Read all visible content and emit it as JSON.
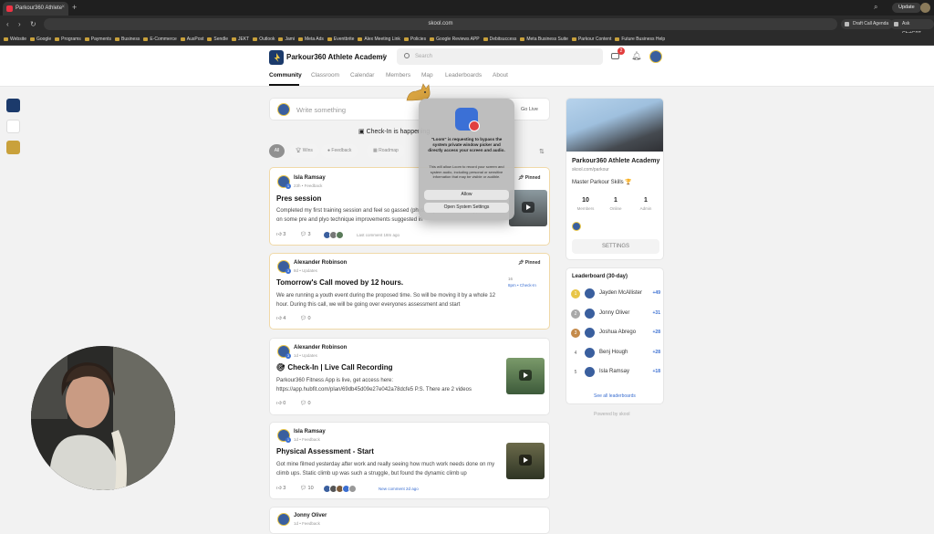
{
  "browser": {
    "tab_title": "Parkour360 Athlete",
    "tab_close": "×",
    "new_tab": "+",
    "url": "skool.com",
    "update_label": "Update",
    "ext_buttons": [
      "Draft Call Agenda",
      "Ask ChatGPT"
    ],
    "bookmarks": [
      "Website",
      "Google",
      "Programs",
      "Payments",
      "Business",
      "E-Commerce",
      "AusPost",
      "Sendle",
      "JEKT",
      "Outlook",
      "Jami",
      "Meta Ads",
      "Eventbrite",
      "Alex Meeting Link",
      "Policies",
      "Google Reviews APP",
      "Debitsuccess",
      "Meta Business Suite",
      "Parkour Content",
      "Future Business Help"
    ]
  },
  "header": {
    "brand": "Parkour360 Athlete Academy",
    "search_placeholder": "Search",
    "notif_count": "2"
  },
  "nav": {
    "tabs": [
      "Community",
      "Classroom",
      "Calendar",
      "Members",
      "Map",
      "Leaderboards",
      "About"
    ]
  },
  "composer": {
    "placeholder": "Write something",
    "go_live": "Go Live"
  },
  "checkin": "Check-In is happening",
  "filters": [
    "All",
    "Wins",
    "Feedback",
    "Roadmap"
  ],
  "posts": [
    {
      "author": "Isla Ramsay",
      "meta": "23h • Feedback",
      "level": "1",
      "pinned": "Pinned",
      "title": "Pres session",
      "body": "Completed my first training session and feel so gassed (physically and emotionally) 😂 Focused on some pre and plyo technique improvements suggested in",
      "likes": "3",
      "comments": "3",
      "activity": "Last comment 18m ago"
    },
    {
      "author": "Alexander Robinson",
      "meta": "8d • Updates",
      "level": "3",
      "pinned": "Pinned",
      "title": "Tomorrow's Call moved by 12 hours.",
      "body": "We are running a youth event during the proposed time. So will be moving it by a whole 12 hour. During this call, we will be going over everyones assessment and start",
      "likes": "4",
      "comments": "0",
      "event_date": "16",
      "event_label": "8pm • Check-In"
    },
    {
      "author": "Alexander Robinson",
      "meta": "1d • Updates",
      "level": "3",
      "title": "Check-In | Live Call Recording",
      "body": "Parkour360 Fitness App is live, get access here: https://app.hubfit.com/plan/69db45d09e27e042a78dcfe5 P.S. There are 2 videos",
      "likes": "0",
      "comments": "0"
    },
    {
      "author": "Isla Ramsay",
      "meta": "1d • Feedback",
      "level": "1",
      "title": "Physical Assessment - Start",
      "body": "Got mine filmed yesterday after work and really seeing how much work needs done on my climb ups. Static climb up was such a struggle, but found the dynamic climb up",
      "likes": "3",
      "comments": "10",
      "activity": "New comment 2d ago"
    },
    {
      "author": "Jonny Oliver",
      "meta": "1d • Feedback",
      "level": "1"
    }
  ],
  "about": {
    "title": "Parkour360 Athlete Academy",
    "url": "skool.com/parkour",
    "tagline": "Master Parkour Skills 🏆",
    "stats": [
      {
        "n": "10",
        "l": "Members"
      },
      {
        "n": "1",
        "l": "Online"
      },
      {
        "n": "1",
        "l": "Admin"
      }
    ],
    "settings": "SETTINGS"
  },
  "leaderboard": {
    "title": "Leaderboard (30-day)",
    "rows": [
      {
        "rank": "1",
        "name": "Jayden McAllister",
        "pts": "+49"
      },
      {
        "rank": "2",
        "name": "Jonny Oliver",
        "pts": "+31"
      },
      {
        "rank": "3",
        "name": "Joshua Abrego",
        "pts": "+28"
      },
      {
        "rank": "4",
        "name": "Benj Hough",
        "pts": "+28"
      },
      {
        "rank": "5",
        "name": "Isla Ramsay",
        "pts": "+18"
      }
    ],
    "see_all": "See all leaderboards"
  },
  "powered": "Powered by skool",
  "dialog": {
    "heading": "\"Loom\" is requesting to bypass the system private window picker and directly access your screen and audio.",
    "body": "This will allow Loom to record your screen and system audio, including personal or sensitive information that may be visible or audible.",
    "allow": "Allow",
    "settings": "Open System Settings"
  },
  "colors": {
    "accent": "#3b6fd1",
    "brand_navy": "#1b3a6b",
    "brand_gold": "#e8c547",
    "pinned_border": "#f0d9a8"
  }
}
